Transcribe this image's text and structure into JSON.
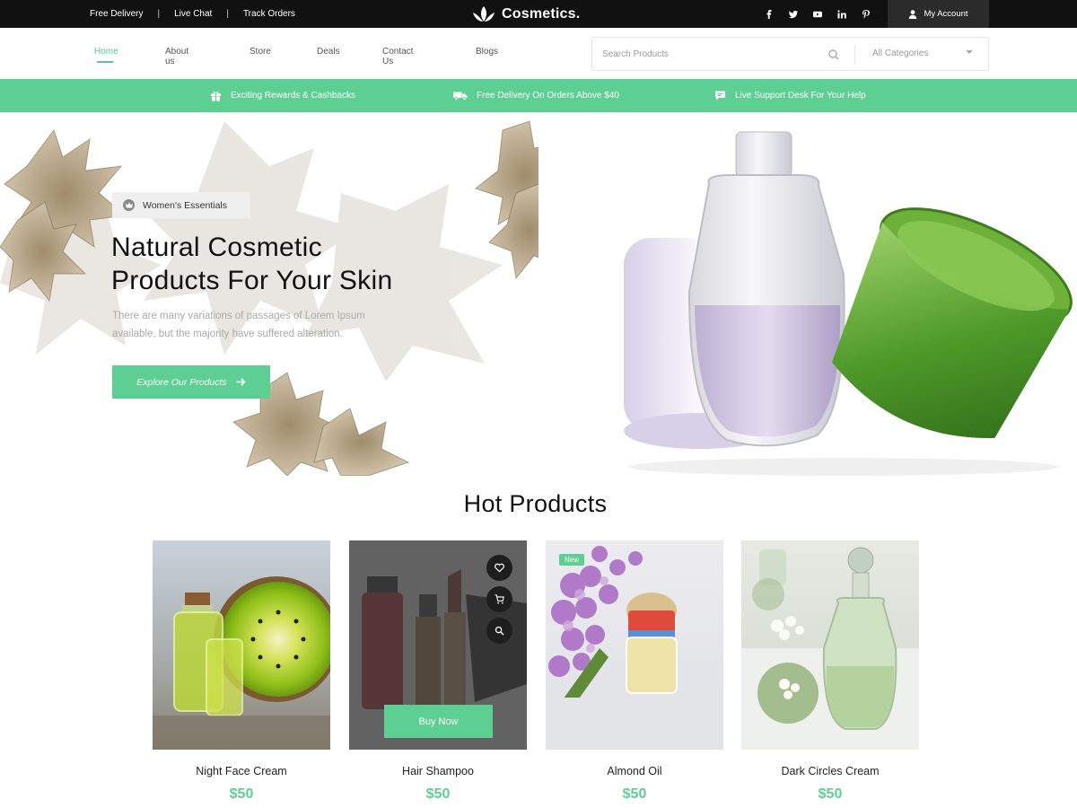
{
  "topbar": {
    "links": [
      "Free Delivery",
      "Live Chat",
      "Track Orders"
    ],
    "separator": "|",
    "brand": "Cosmetics.",
    "social_icons": [
      "facebook-icon",
      "twitter-icon",
      "youtube-icon",
      "linkedin-icon",
      "pinterest-icon"
    ],
    "account_label": "My Account"
  },
  "nav": {
    "items": [
      "Home",
      "About us",
      "Store",
      "Deals",
      "Contact Us",
      "Blogs"
    ],
    "active": "Home"
  },
  "search": {
    "placeholder": "Search Products",
    "category": "All Categories"
  },
  "promo": {
    "items": [
      "Exciting Rewards & Cashbacks",
      "Free Delivery On Orders Above $40",
      "Live Support Desk For Your Help"
    ]
  },
  "hero": {
    "badge": "Women's Essentials",
    "title_line1": "Natural Cosmetic",
    "title_line2": "Products For Your Skin",
    "desc_line1": "There are many variations of passages of Lorem Ipsum",
    "desc_line2": "available, but the majority have suffered alteration.",
    "cta": "Explore Our Products"
  },
  "hot": {
    "title": "Hot Products",
    "buy_now": "Buy Now",
    "new_badge": "New",
    "products": [
      {
        "name": "Night Face Cream",
        "price": "$50"
      },
      {
        "name": "Hair Shampoo",
        "price": "$50"
      },
      {
        "name": "Almond Oil",
        "price": "$50"
      },
      {
        "name": "Dark Circles Cream",
        "price": "$50"
      }
    ]
  },
  "colors": {
    "accent": "#5ecf92",
    "topbar": "#111111",
    "account_bg": "#2b2b2b"
  }
}
